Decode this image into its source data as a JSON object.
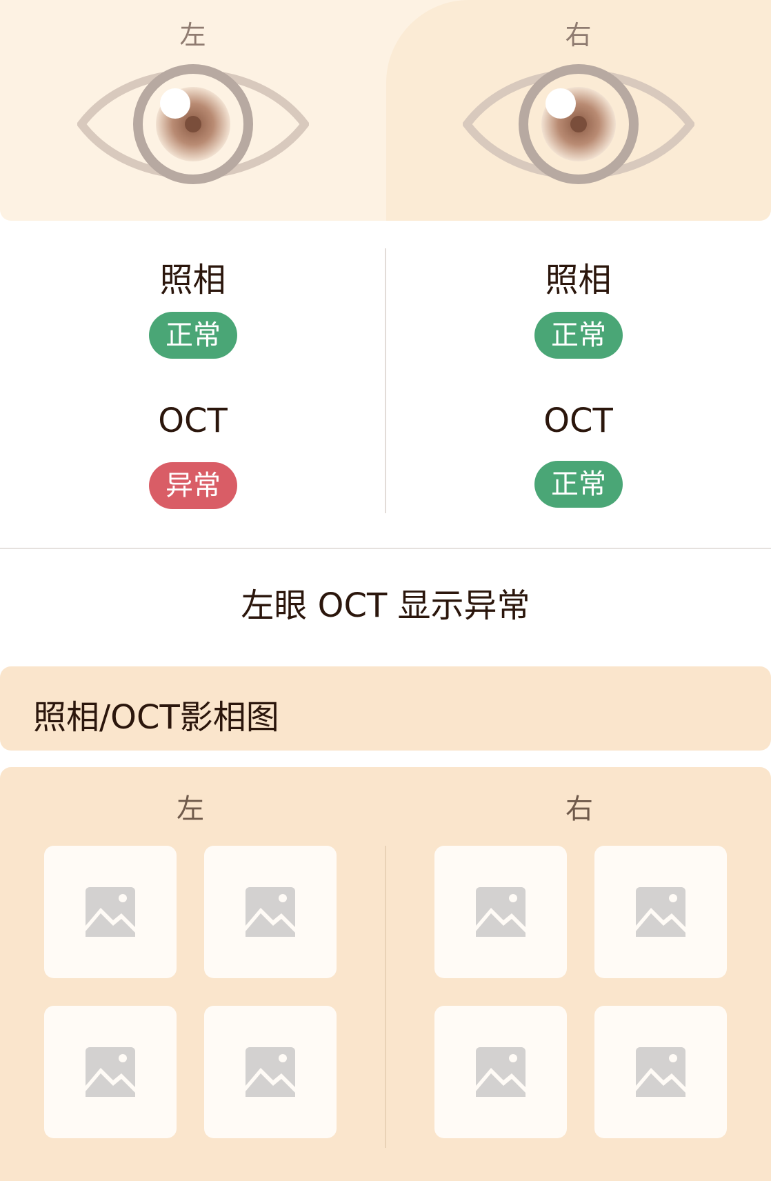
{
  "eyes": {
    "left_label": "左",
    "right_label": "右"
  },
  "results": {
    "left": {
      "photo_label": "照相",
      "photo_status": "正常",
      "oct_label": "OCT",
      "oct_status": "异常"
    },
    "right": {
      "photo_label": "照相",
      "photo_status": "正常",
      "oct_label": "OCT",
      "oct_status": "正常"
    }
  },
  "summary": "左眼 OCT 显示异常",
  "images": {
    "title": "照相/OCT影相图",
    "left_label": "左",
    "right_label": "右"
  },
  "colors": {
    "normal": "#4aa676",
    "abnormal": "#d95d66",
    "panel": "#fae5cc"
  }
}
